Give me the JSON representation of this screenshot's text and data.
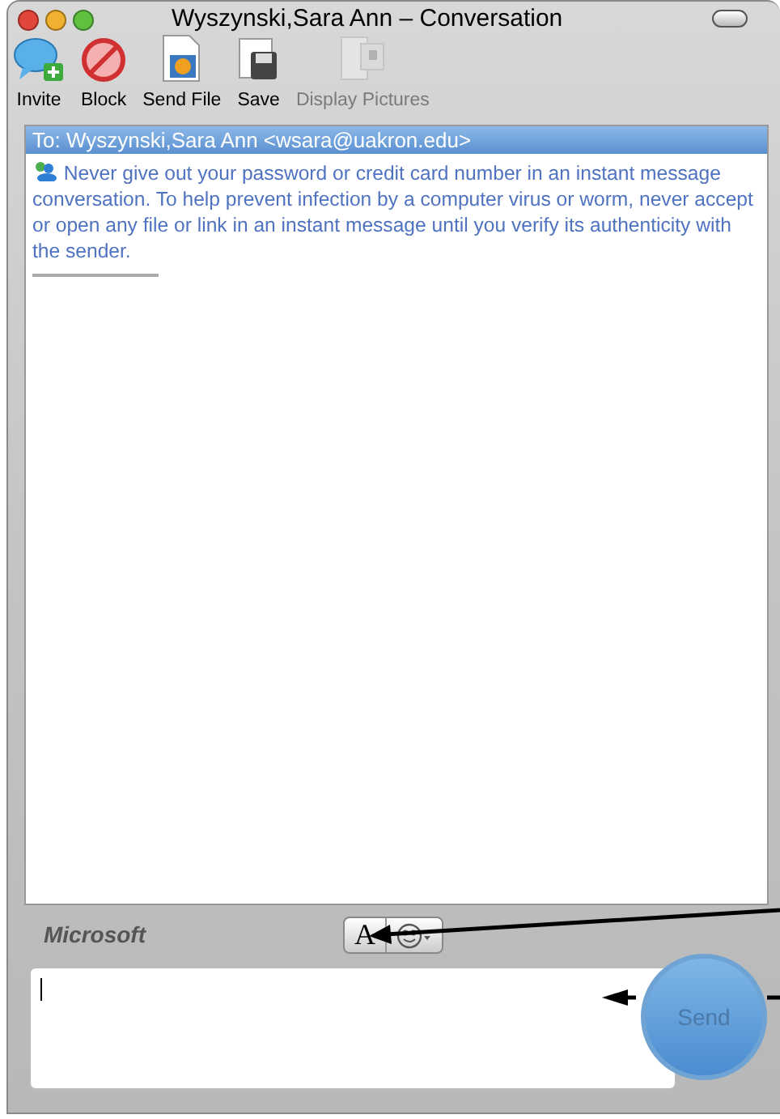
{
  "window": {
    "title": "Wyszynski,Sara Ann – Conversation"
  },
  "toolbar": [
    {
      "label": "Invite",
      "kind": "invite",
      "disabled": false
    },
    {
      "label": "Block",
      "kind": "block",
      "disabled": false
    },
    {
      "label": "Send File",
      "kind": "send_file",
      "disabled": false
    },
    {
      "label": "Save",
      "kind": "save",
      "disabled": false
    },
    {
      "label": "Display Pictures",
      "kind": "display_pictures",
      "disabled": true
    }
  ],
  "conversation": {
    "header": "To: Wyszynski,Sara Ann <wsara@uakron.edu>",
    "notice": "Never give out your password or credit card number in an instant message conversation. To help prevent infection by a computer virus or worm, never accept or open any file or link in an instant message until you verify its authenticity with the sender."
  },
  "format_bar": {
    "brand": "Microsoft",
    "buttons": [
      {
        "kind": "font",
        "label": "A"
      },
      {
        "kind": "emoticon"
      }
    ]
  },
  "send_button": {
    "label": "Send"
  }
}
